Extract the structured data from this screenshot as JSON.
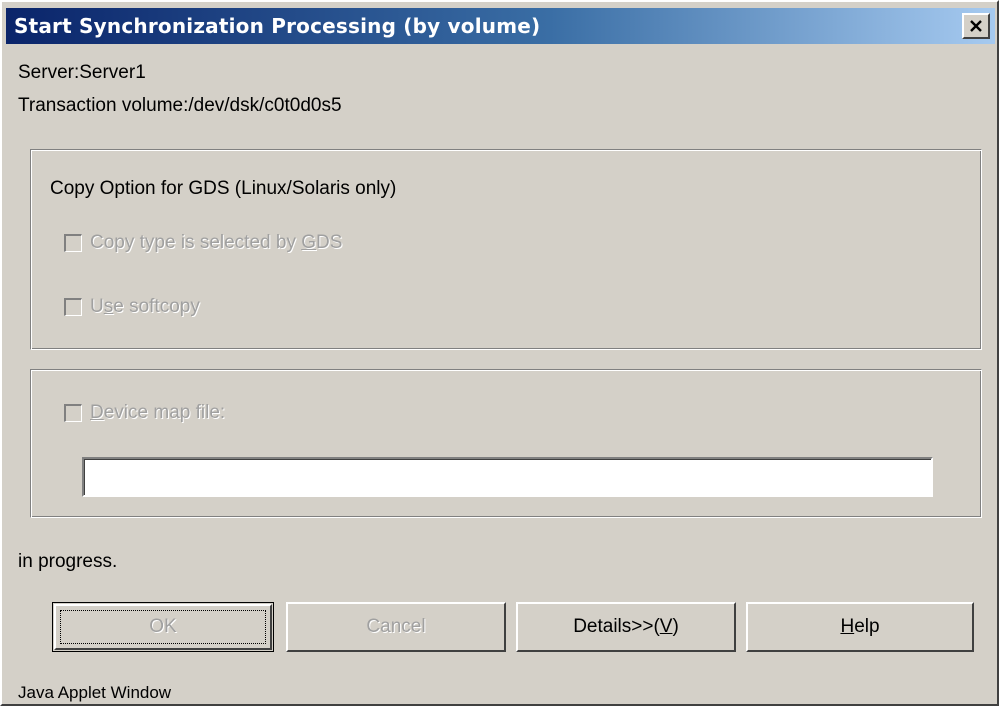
{
  "window": {
    "title": "Start Synchronization Processing (by volume)",
    "close_icon": "close-icon",
    "footer": "Java Applet Window"
  },
  "info": {
    "server": "Server:Server1",
    "transaction_volume": "Transaction volume:/dev/dsk/c0t0d0s5"
  },
  "gds_group": {
    "heading": "Copy Option for GDS (Linux/Solaris only)",
    "option1": {
      "pre": "Copy type is selected by ",
      "mnemonic": "G",
      "post": "DS",
      "checked": false,
      "enabled": false
    },
    "option2": {
      "pre": "U",
      "mnemonic": "s",
      "post": "e softcopy",
      "checked": false,
      "enabled": false
    }
  },
  "device_map": {
    "checkbox": {
      "pre": "",
      "mnemonic": "D",
      "post": "evice map file:",
      "checked": false,
      "enabled": false
    },
    "value": "",
    "placeholder": ""
  },
  "status": {
    "text": "in progress."
  },
  "buttons": {
    "ok": "OK",
    "cancel": "Cancel",
    "details_pre": "Details>>(",
    "details_mnemonic": "V",
    "details_post": ")",
    "help_mnemonic": "H",
    "help_post": "elp"
  },
  "colors": {
    "title_gradient_start": "#0a246a",
    "title_gradient_end": "#a6caf0",
    "face": "#d4d0c8",
    "disabled_text": "#a0a0a0"
  }
}
